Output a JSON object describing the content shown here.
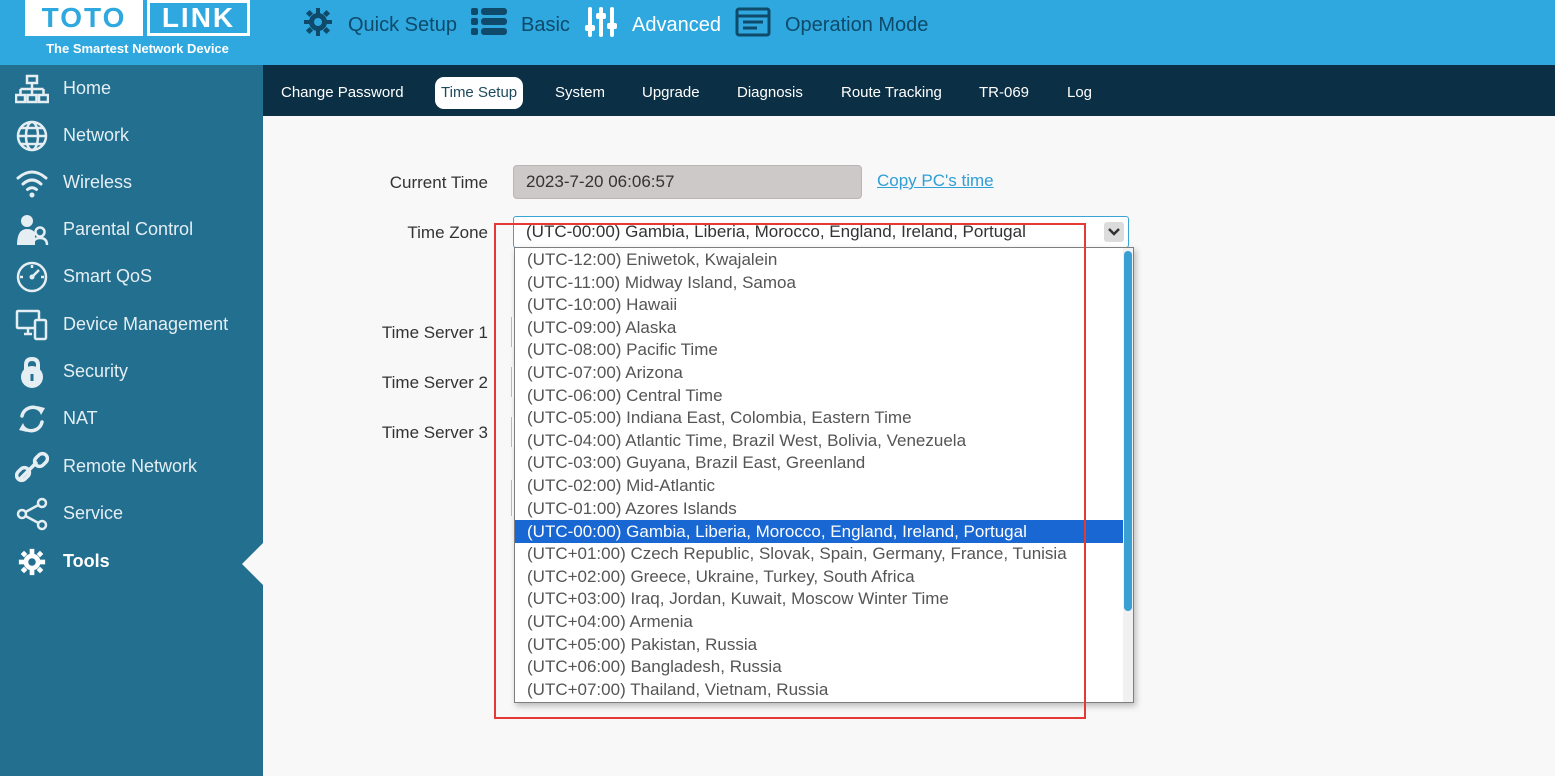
{
  "logo": {
    "brand_left": "TOTO",
    "brand_right": "LINK",
    "tagline": "The Smartest Network Device"
  },
  "topnav": [
    {
      "label": "Quick Setup",
      "icon": "gear-icon"
    },
    {
      "label": "Basic",
      "icon": "list-icon"
    },
    {
      "label": "Advanced",
      "icon": "sliders-icon",
      "active": true
    },
    {
      "label": "Operation Mode",
      "icon": "window-icon"
    }
  ],
  "sidebar": {
    "items": [
      {
        "label": "Home",
        "icon": "network-tree-icon"
      },
      {
        "label": "Network",
        "icon": "globe-icon"
      },
      {
        "label": "Wireless",
        "icon": "wifi-icon"
      },
      {
        "label": "Parental Control",
        "icon": "parent-child-icon"
      },
      {
        "label": "Smart QoS",
        "icon": "gauge-icon"
      },
      {
        "label": "Device Management",
        "icon": "devices-icon"
      },
      {
        "label": "Security",
        "icon": "lock-icon"
      },
      {
        "label": "NAT",
        "icon": "refresh-icon"
      },
      {
        "label": "Remote Network",
        "icon": "link-icon"
      },
      {
        "label": "Service",
        "icon": "share-icon"
      },
      {
        "label": "Tools",
        "icon": "gear-icon",
        "active": true
      }
    ]
  },
  "subnav": {
    "items": [
      {
        "label": "Change Password"
      },
      {
        "label": "Time Setup",
        "active": true
      },
      {
        "label": "System"
      },
      {
        "label": "Upgrade"
      },
      {
        "label": "Diagnosis"
      },
      {
        "label": "Route Tracking"
      },
      {
        "label": "TR-069"
      },
      {
        "label": "Log"
      }
    ]
  },
  "form": {
    "current_time_label": "Current Time",
    "current_time_value": "2023-7-20 06:06:57",
    "copy_pc_time": "Copy PC's time",
    "time_zone_label": "Time Zone",
    "time_zone_selected": "(UTC-00:00) Gambia, Liberia, Morocco, England, Ireland, Portugal",
    "time_server_1_label": "Time Server 1",
    "time_server_2_label": "Time Server 2",
    "time_server_3_label": "Time Server 3"
  },
  "timezone_options": [
    "(UTC-12:00) Eniwetok, Kwajalein",
    "(UTC-11:00) Midway Island, Samoa",
    "(UTC-10:00) Hawaii",
    "(UTC-09:00) Alaska",
    "(UTC-08:00) Pacific Time",
    "(UTC-07:00) Arizona",
    "(UTC-06:00) Central Time",
    "(UTC-05:00) Indiana East, Colombia, Eastern Time",
    "(UTC-04:00) Atlantic Time, Brazil West, Bolivia, Venezuela",
    "(UTC-03:00) Guyana, Brazil East, Greenland",
    "(UTC-02:00) Mid-Atlantic",
    "(UTC-01:00) Azores Islands",
    "(UTC-00:00) Gambia, Liberia, Morocco, England, Ireland, Portugal",
    "(UTC+01:00) Czech Republic, Slovak, Spain, Germany, France, Tunisia",
    "(UTC+02:00) Greece, Ukraine, Turkey, South Africa",
    "(UTC+03:00) Iraq, Jordan, Kuwait, Moscow Winter Time",
    "(UTC+04:00) Armenia",
    "(UTC+05:00) Pakistan, Russia",
    "(UTC+06:00) Bangladesh, Russia",
    "(UTC+07:00) Thailand, Vietnam, Russia"
  ],
  "selected_option_index": 12,
  "colors": {
    "header": "#2ea8df",
    "sidebar": "#236f8f",
    "subnav": "#0b2f44",
    "selected": "#1967d2",
    "highlight": "#e53935"
  }
}
